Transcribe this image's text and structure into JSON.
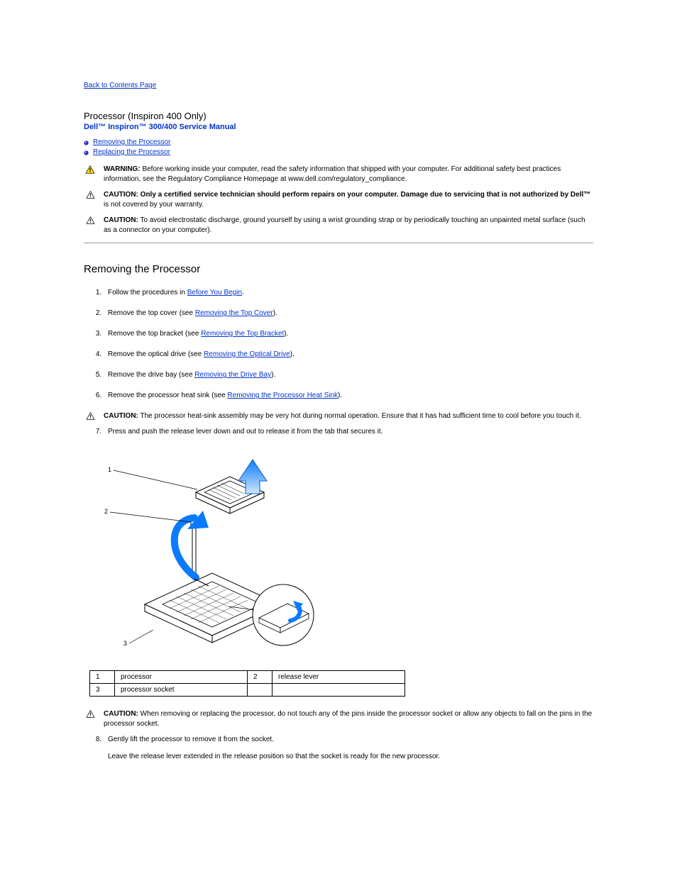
{
  "back_link": "Back to Contents Page",
  "title": "Processor (Inspiron 400 Only)",
  "subtitle": "Dell™ Inspiron™ 300/400 Service Manual",
  "toc": {
    "item1": "Removing the Processor",
    "item2": "Replacing the Processor"
  },
  "warning": {
    "label": "WARNING:",
    "text": "Before working inside your computer, read the safety information that shipped with your computer. For additional safety best practices information, see the Regulatory Compliance Homepage at www.dell.com/regulatory_compliance."
  },
  "caution1": {
    "label": "CAUTION:",
    "lead": "Only a certified service technician should perform repairs on your computer. Damage due to servicing that is not authorized by Dell™",
    "tail": "is not covered by your warranty."
  },
  "caution2": {
    "label": "CAUTION:",
    "text": "To avoid electrostatic discharge, ground yourself by using a wrist grounding strap or by periodically touching an unpainted metal surface (such as a connector on your computer)."
  },
  "section_title": "Removing the Processor",
  "steps": {
    "s1a": "Follow the procedures in ",
    "s1l": "Before You Begin",
    "s1b": ".",
    "s2a": "Remove the top cover (see ",
    "s2l": "Removing the Top Cover",
    "s2b": ").",
    "s3a": "Remove the top bracket (see ",
    "s3l": "Removing the Top Bracket",
    "s3b": ").",
    "s4a": "Remove the optical drive (see ",
    "s4l": "Removing the Optical Drive",
    "s4b": ").",
    "s5a": "Remove the drive bay (see ",
    "s5l": "Removing the Drive Bay",
    "s5b": ").",
    "s6a": "Remove the processor heat sink (see ",
    "s6l": "Removing the Processor Heat Sink",
    "s6b": ")."
  },
  "caution3": {
    "label": "CAUTION:",
    "text": "The processor heat-sink assembly may be very hot during normal operation. Ensure that it has had sufficient time to cool before you touch it."
  },
  "step7": "Press and push the release lever down and out to release it from the tab that secures it.",
  "legend": {
    "n1": "1",
    "l1": "processor",
    "n2": "2",
    "l2": "release lever",
    "n3": "3",
    "l3": "processor socket"
  },
  "caution4": {
    "label": "CAUTION:",
    "text": "When removing or replacing the processor, do not touch any of the pins inside the processor socket or allow any objects to fall on the pins in the processor socket."
  },
  "step8": "Gently lift the processor to remove it from the socket.",
  "step8b": "Leave the release lever extended in the release position so that the socket is ready for the new processor."
}
